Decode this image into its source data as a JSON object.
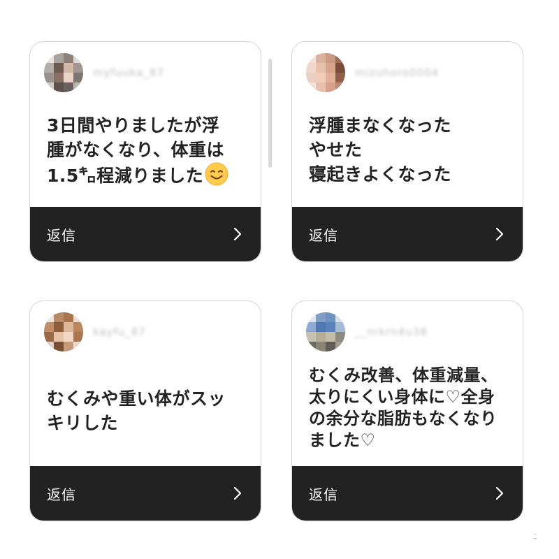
{
  "cards": [
    {
      "username": "myfuuka_87",
      "comment": "3日間やりましたが浮\n腫がなくなり、体重は\n1.5㌔程減りました",
      "emoji": "smiling-face-emoji",
      "reply_label": "返信"
    },
    {
      "username": "mizuhoro0004",
      "comment": "浮腫まなくなった\nやせた\n寝起きよくなった",
      "reply_label": "返信"
    },
    {
      "username": "kayfu_87",
      "comment": "むくみや重い体がスッ\nキリした",
      "reply_label": "返信"
    },
    {
      "username": "__nrkrn4u38",
      "comment": "むくみ改善、体重減量、\n太りにくい身体に♡全身\nの余分な脂肪もなくなり\nました♡",
      "reply_label": "返信"
    }
  ],
  "icons": {
    "reply": "chevron-right-icon"
  },
  "colors": {
    "reply_bar": "#222222",
    "card_border": "#d6d6d6",
    "comment_text": "#222222"
  }
}
